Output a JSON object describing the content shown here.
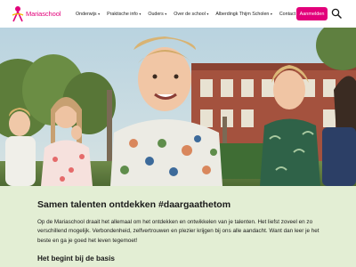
{
  "brand": {
    "name": "Mariaschool",
    "accent": "#e2007a",
    "band_color": "#e3eed4"
  },
  "nav": {
    "items": [
      {
        "label": "Onderwijs",
        "has_dropdown": true
      },
      {
        "label": "Praktische info",
        "has_dropdown": true
      },
      {
        "label": "Ouders",
        "has_dropdown": true
      },
      {
        "label": "Over de school",
        "has_dropdown": true
      },
      {
        "label": "Alberdingk Thijm Scholen",
        "has_dropdown": true
      },
      {
        "label": "Contact",
        "has_dropdown": false
      }
    ],
    "cta_label": "Aanmelden",
    "search_icon": "search-icon",
    "dropdown_icon": "chevron-down-icon"
  },
  "hero": {
    "image": "photo of smiling schoolchildren outdoors in front of a brick school building"
  },
  "intro": {
    "headline": "Samen talenten ontdekken #daargaathetom",
    "paragraph": "Op de Mariaschool draait het allemaal om het ontdekken en ontwikkelen van je talenten. Het liefst zoveel en zo verschillend mogelijk. Verbondenheid, zelfvertrouwen en plezier krijgen bij ons alle aandacht. Want dan leer je het beste en ga je goed het leven tegemoet!",
    "subheading": "Het begint bij de basis"
  }
}
